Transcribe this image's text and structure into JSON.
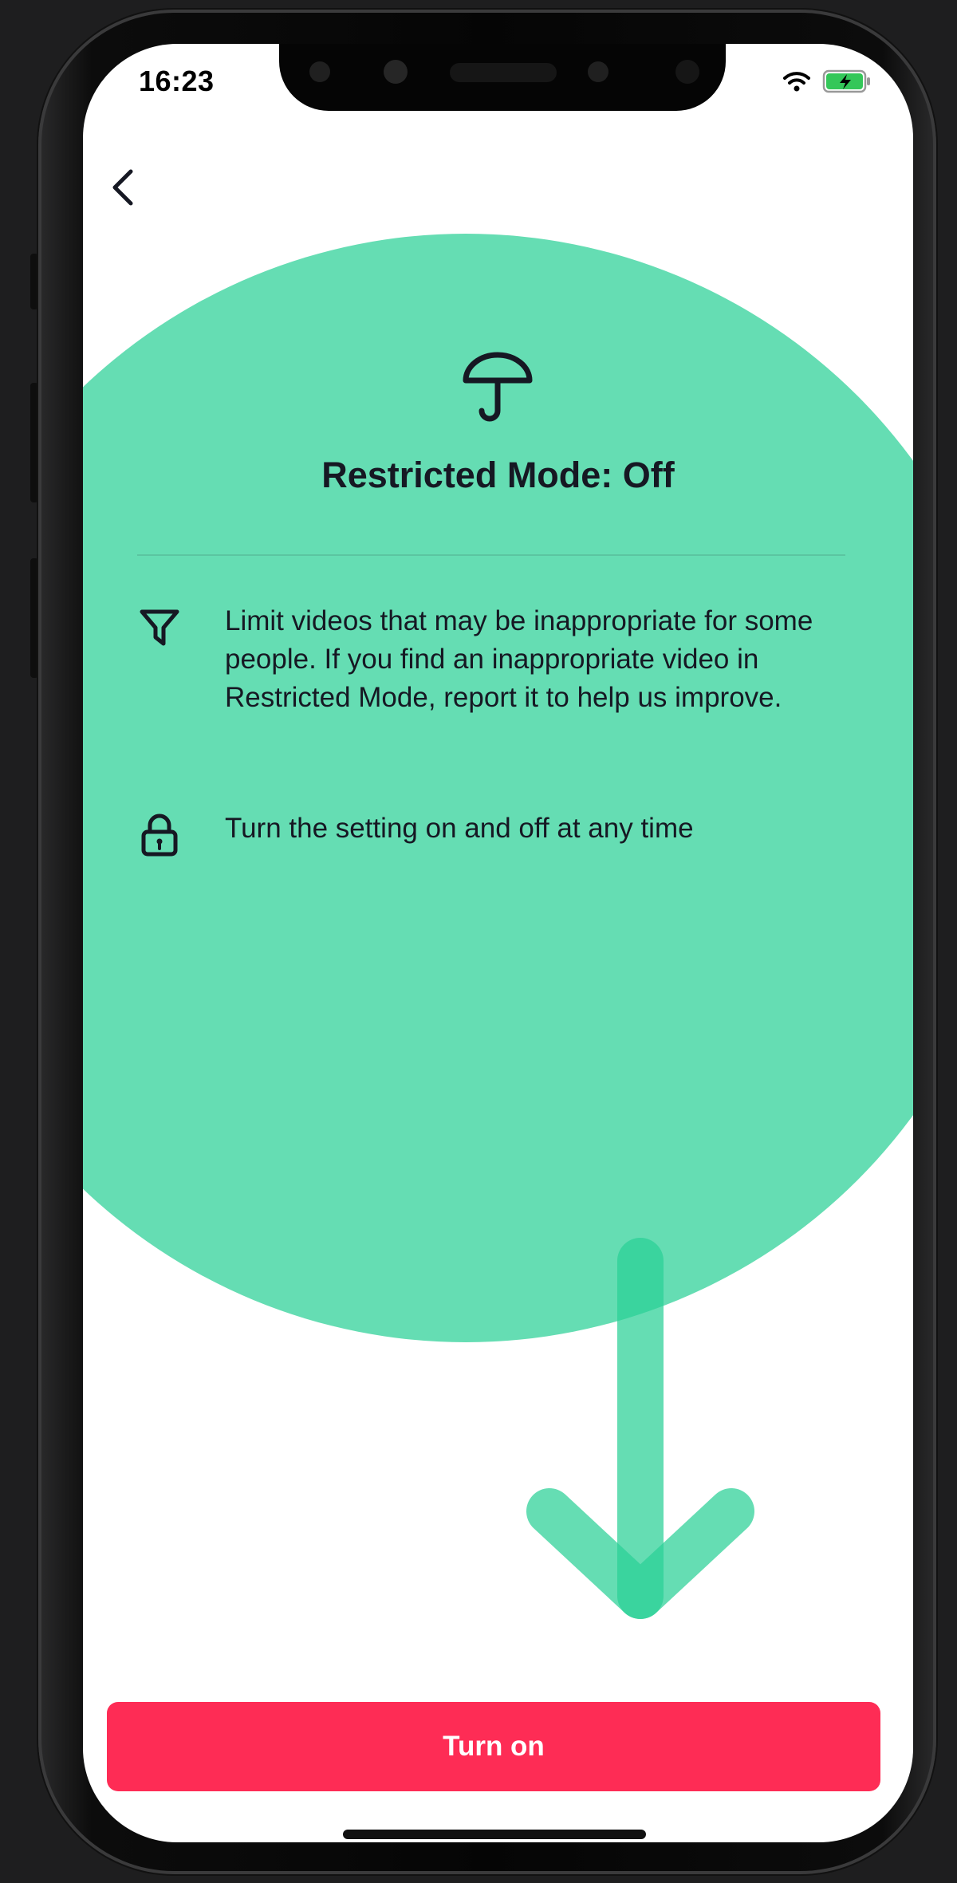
{
  "status_bar": {
    "time": "16:23",
    "icons": [
      "wifi-icon",
      "battery-charging-icon"
    ],
    "battery_color": "#34c759"
  },
  "header": {
    "back_icon": "chevron-left-icon"
  },
  "main": {
    "hero_icon": "umbrella-icon",
    "title": "Restricted Mode: Off",
    "features": [
      {
        "icon": "filter-icon",
        "text": "Limit videos that may be inappropriate for some people. If you find an inappropriate video in Restricted Mode, report it to help us improve."
      },
      {
        "icon": "lock-icon",
        "text": "Turn the setting on and off at any time"
      }
    ]
  },
  "footer": {
    "turn_on_label": "Turn on",
    "button_color": "#fe2c55"
  },
  "overlay": {
    "highlight_color": "#2ad096",
    "arrow_icon": "arrow-down-icon"
  }
}
